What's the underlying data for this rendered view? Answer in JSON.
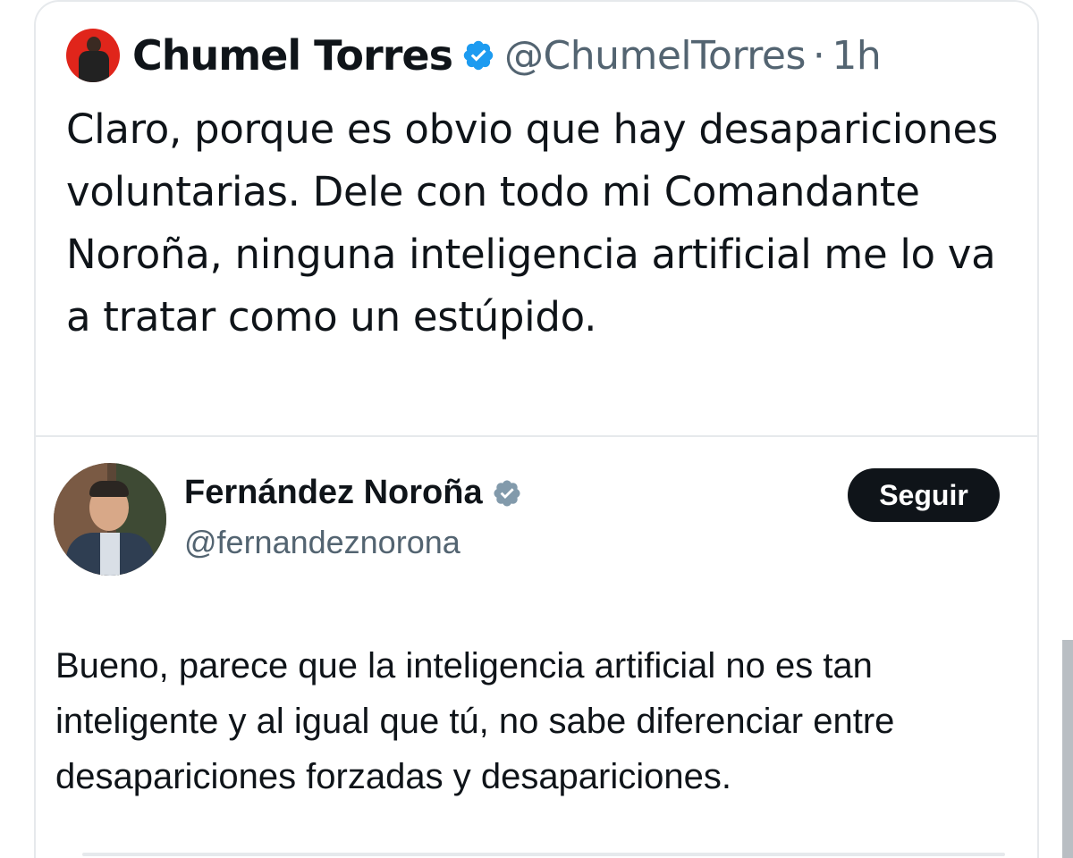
{
  "tweet": {
    "author_name": "Chumel Torres",
    "handle": "@ChumelTorres",
    "separator": "·",
    "time": "1h",
    "text": "Claro, porque es obvio que hay desapariciones voluntarias. Dele con todo mi Comandante Noroña, ninguna inteligencia artificial me lo va a tratar como un estúpido.",
    "avatar_icon": "profile-photo",
    "verified_icon": "verified-badge-icon"
  },
  "quoted_tweet": {
    "author_name": "Fernández Noroña",
    "handle": "@fernandeznorona",
    "follow_label": "Seguir",
    "text": "Bueno, parece que la inteligencia artificial no es tan inteligente y al igual que tú, no sabe diferenciar entre desapariciones forzadas y desapariciones.",
    "avatar_icon": "profile-photo",
    "verified_icon": "verified-badge-icon"
  },
  "colors": {
    "verified_blue": "#1d9bf0",
    "verified_gray": "#829aab",
    "text_primary": "#0f1419",
    "text_secondary": "#536471",
    "follow_bg": "#0f1419",
    "avatar_red": "#e0251b"
  }
}
